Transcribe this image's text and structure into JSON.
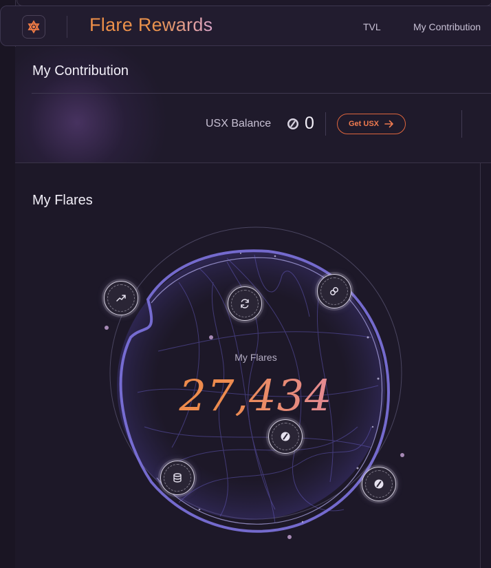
{
  "header": {
    "title": "Flare Rewards",
    "nav": [
      "TVL",
      "My Contribution"
    ]
  },
  "contribution": {
    "title": "My Contribution",
    "balance_label": "USX Balance",
    "balance_value": "0",
    "get_button_label": "Get USX"
  },
  "flares": {
    "title": "My Flares",
    "center_label": "My Flares",
    "value": "27,434"
  },
  "orbs": [
    {
      "name": "trending-up-icon"
    },
    {
      "name": "refresh-icon"
    },
    {
      "name": "link-icon"
    },
    {
      "name": "usx-token-icon"
    },
    {
      "name": "coins-stack-icon"
    },
    {
      "name": "usx-token-icon"
    }
  ],
  "colors": {
    "accent_orange": "#f08c3f",
    "button_border": "#e0663d",
    "globe_purple": "#7b6fe0",
    "background": "#1c1727"
  }
}
